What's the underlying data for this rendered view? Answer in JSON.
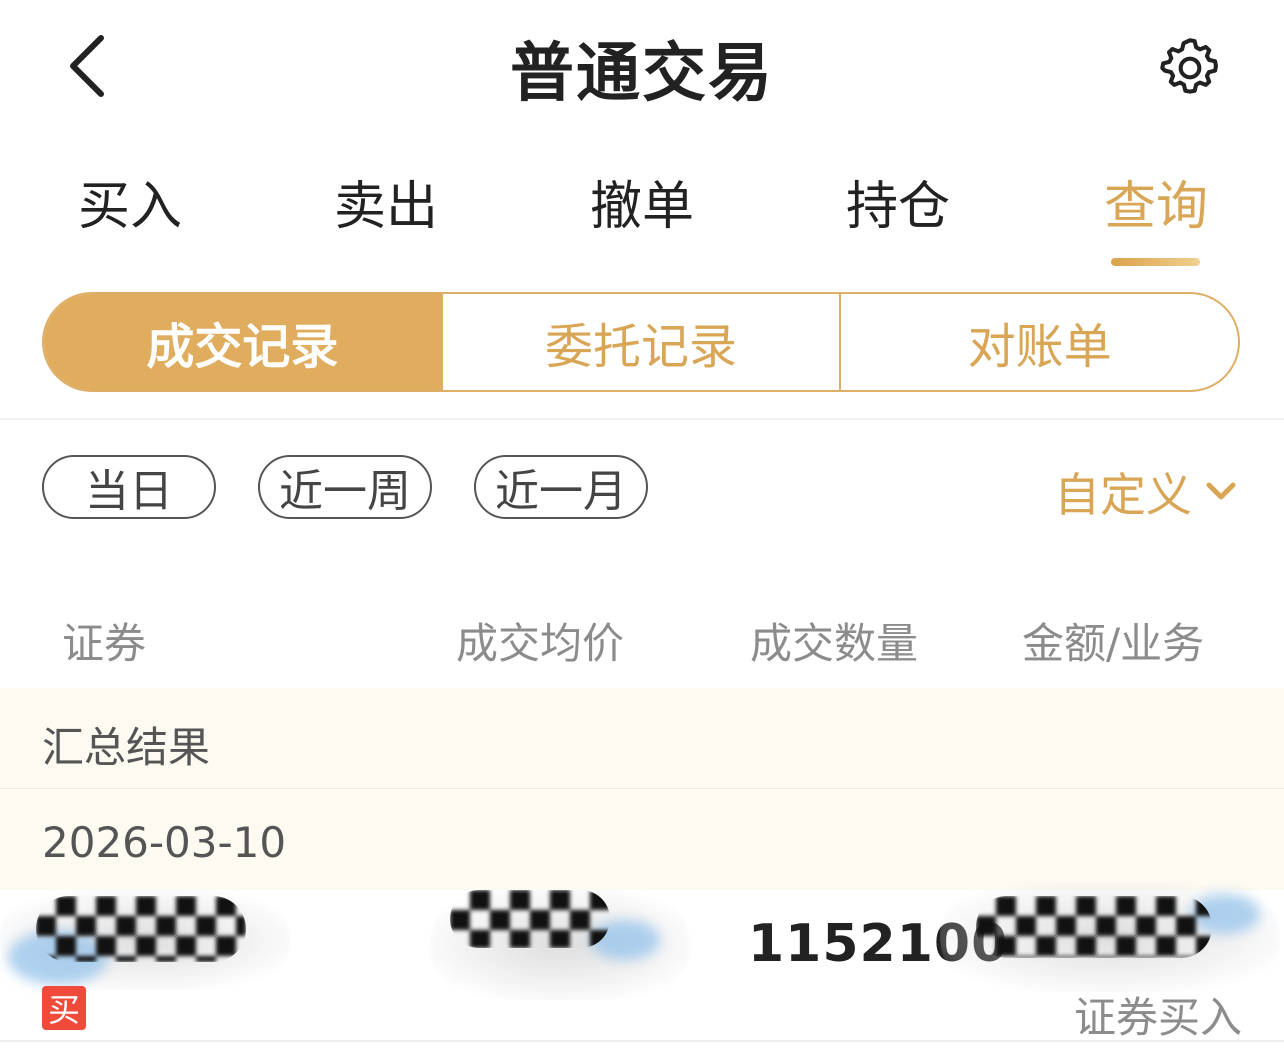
{
  "header": {
    "title": "普通交易",
    "back_icon": "chevron-left-icon",
    "settings_icon": "gear-icon"
  },
  "tabs": [
    {
      "label": "买入",
      "active": false
    },
    {
      "label": "卖出",
      "active": false
    },
    {
      "label": "撤单",
      "active": false
    },
    {
      "label": "持仓",
      "active": false
    },
    {
      "label": "查询",
      "active": true
    }
  ],
  "segments": [
    {
      "label": "成交记录",
      "active": true
    },
    {
      "label": "委托记录",
      "active": false
    },
    {
      "label": "对账单",
      "active": false
    }
  ],
  "filters": {
    "chips": [
      "当日",
      "近一周",
      "近一月"
    ],
    "custom_label": "自定义"
  },
  "columns": [
    "证券",
    "成交均价",
    "成交数量",
    "金额/业务"
  ],
  "summary_label": "汇总结果",
  "date_label": "2026-03-10",
  "record": {
    "quantity": "1152100",
    "side_badge": "买",
    "business": "证券买入"
  },
  "colors": {
    "accent": "#e0ac5e",
    "buy_badge": "#f04a3a",
    "summary_bg": "#fdfaf1"
  }
}
